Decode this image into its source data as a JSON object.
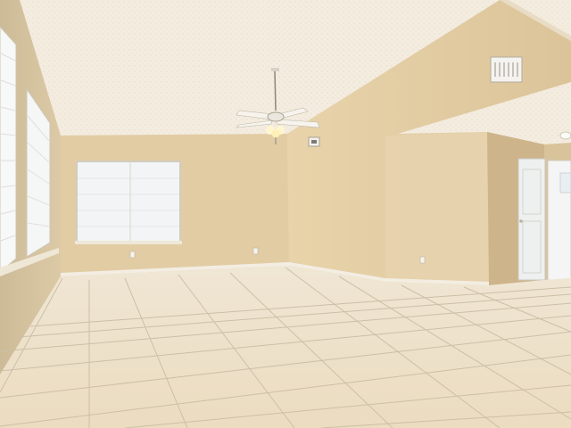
{
  "scene": {
    "subject": "empty-room-interior",
    "colors": {
      "ceiling": "#f3ecdf",
      "wall_back": "#e4cfa8",
      "wall_right": "#ead6ae",
      "wall_left": "#d8c7a6",
      "floor": "#efe3cd",
      "grout": "#c9bca6",
      "window_glass": "#f4f6f7",
      "door": "#eef0ef",
      "baseboard": "#f2ece0"
    }
  }
}
